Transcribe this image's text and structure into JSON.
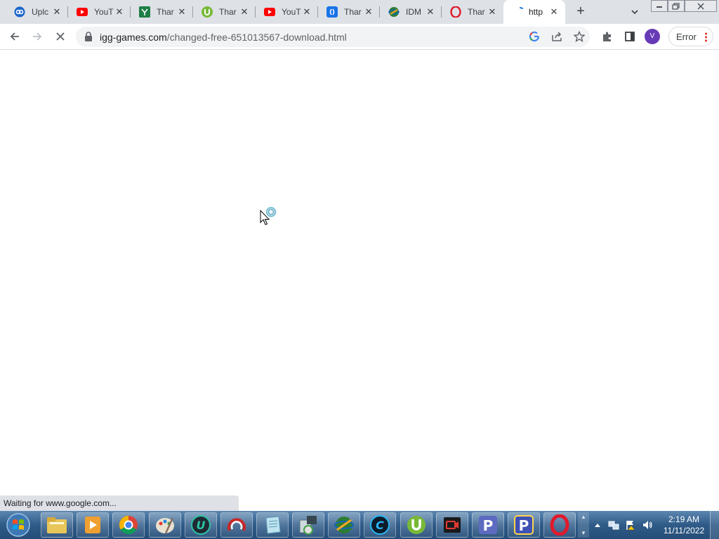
{
  "browser": {
    "tabs": [
      {
        "title": "Uplc",
        "icon": "uploaded-logo-icon",
        "active": false
      },
      {
        "title": "YouT",
        "icon": "youtube-icon",
        "active": false
      },
      {
        "title": "Thar",
        "icon": "sheet-icon",
        "active": false
      },
      {
        "title": "Thar",
        "icon": "utorrent-icon",
        "active": false
      },
      {
        "title": "YouT",
        "icon": "youtube-icon",
        "active": false
      },
      {
        "title": "Thar",
        "icon": "bracket-icon",
        "active": false
      },
      {
        "title": "IDM",
        "icon": "idm-globe-icon",
        "active": false
      },
      {
        "title": "Thar",
        "icon": "opera-icon",
        "active": false
      },
      {
        "title": "http",
        "icon": "loading-icon",
        "active": true
      }
    ],
    "close_glyph": "✕",
    "new_tab_glyph": "+",
    "address": {
      "domain": "igg-games.com",
      "path": "/changed-free-651013567-download.html"
    },
    "profile_initial": "V",
    "error_label": "Error"
  },
  "status_bar": {
    "text": "Waiting for www.google.com..."
  },
  "taskbar": {
    "apps": [
      {
        "name": "file-explorer"
      },
      {
        "name": "media-player"
      },
      {
        "name": "chrome"
      },
      {
        "name": "paint"
      },
      {
        "name": "u-app"
      },
      {
        "name": "ccleaner-like"
      },
      {
        "name": "notepad-like"
      },
      {
        "name": "installer"
      },
      {
        "name": "idm"
      },
      {
        "name": "c-app"
      },
      {
        "name": "utorrent"
      },
      {
        "name": "screen-recorder"
      },
      {
        "name": "p-app"
      },
      {
        "name": "p-app-2"
      },
      {
        "name": "opera"
      }
    ],
    "clock": {
      "time": "2:19 AM",
      "date": "11/11/2022"
    }
  },
  "colors": {
    "tabstrip": "#dee1e6",
    "taskbar": "#2f5b88",
    "profile": "#673ab7"
  }
}
